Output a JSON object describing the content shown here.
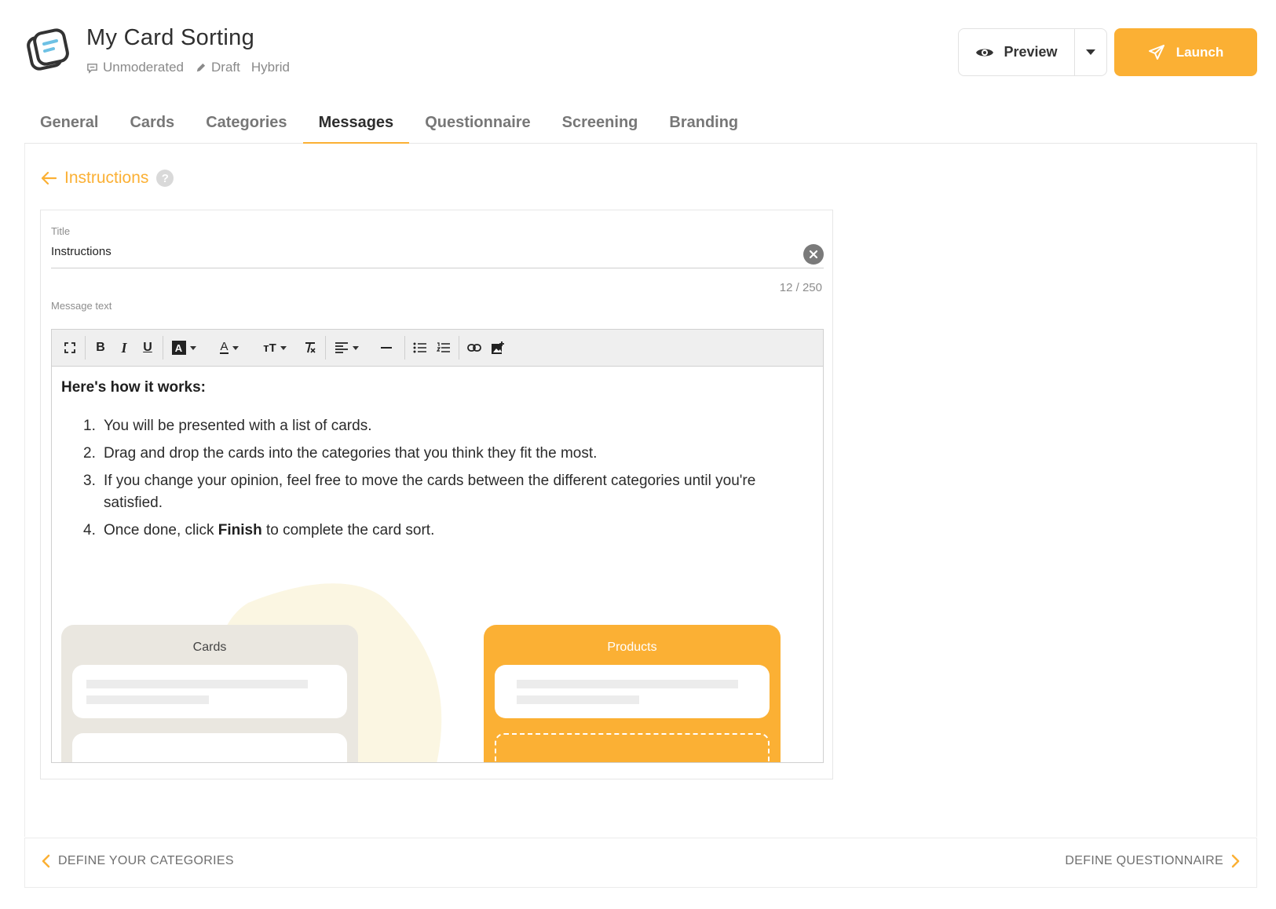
{
  "header": {
    "title": "My Card Sorting",
    "meta": [
      {
        "icon": "chat-icon",
        "label": "Unmoderated"
      },
      {
        "icon": "pencil-icon",
        "label": "Draft"
      },
      {
        "icon": "",
        "label": "Hybrid"
      }
    ],
    "preview_label": "Preview",
    "launch_label": "Launch"
  },
  "tabs": [
    {
      "label": "General",
      "active": false
    },
    {
      "label": "Cards",
      "active": false
    },
    {
      "label": "Categories",
      "active": false
    },
    {
      "label": "Messages",
      "active": true
    },
    {
      "label": "Questionnaire",
      "active": false
    },
    {
      "label": "Screening",
      "active": false
    },
    {
      "label": "Branding",
      "active": false
    }
  ],
  "section": {
    "back_label": "Instructions",
    "help": "?"
  },
  "form": {
    "title_label": "Title",
    "title_value": "Instructions",
    "counter": "12 / 250",
    "message_label": "Message text"
  },
  "editor": {
    "heading": "Here's how it works:",
    "steps": [
      {
        "num": "1.",
        "pre": "You will be presented with a list of cards.",
        "bold": "",
        "post": ""
      },
      {
        "num": "2.",
        "pre": "Drag and drop the cards into the categories that you think they fit the most.",
        "bold": "",
        "post": ""
      },
      {
        "num": "3.",
        "pre": "If you change your opinion, feel free to move the cards between the different categories until you're satisfied.",
        "bold": "",
        "post": ""
      },
      {
        "num": "4.",
        "pre": "Once done, click ",
        "bold": "Finish",
        "post": " to complete the card sort."
      }
    ],
    "illustration": {
      "left_title": "Cards",
      "right_title": "Products"
    }
  },
  "footer": {
    "prev_label": "DEFINE YOUR CATEGORIES",
    "next_label": "DEFINE QUESTIONNAIRE"
  },
  "colors": {
    "accent": "#fbb034",
    "tab_active": "#2d2d2d",
    "muted": "#8a8a8a"
  }
}
